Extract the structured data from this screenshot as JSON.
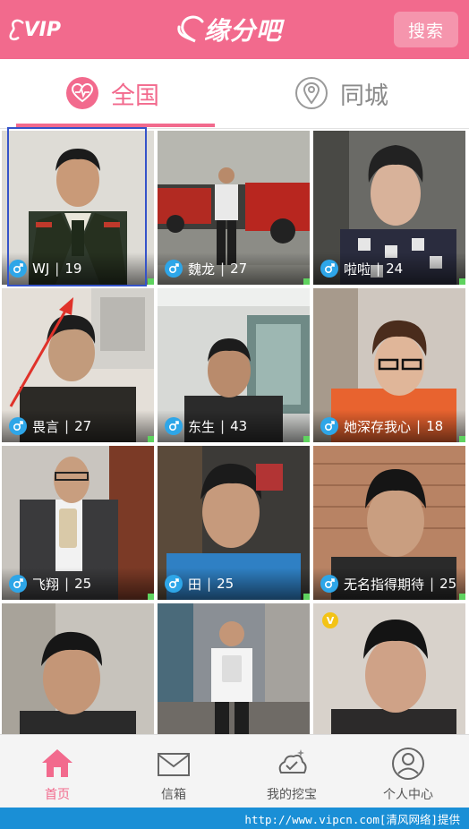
{
  "header": {
    "vip_label": "VIP",
    "logo_text": "缘分吧",
    "search_label": "搜索",
    "brand_color": "#f26a8d"
  },
  "tabs": [
    {
      "label": "全国",
      "icon": "heart-pulse-icon",
      "active": true
    },
    {
      "label": "同城",
      "icon": "location-pin-icon",
      "active": false
    }
  ],
  "users": [
    {
      "name": "WJ",
      "age": "19",
      "gender": "male"
    },
    {
      "name": "魏龙",
      "age": "27",
      "gender": "male"
    },
    {
      "name": "啦啦",
      "age": "24",
      "gender": "male"
    },
    {
      "name": "畏言",
      "age": "27",
      "gender": "male"
    },
    {
      "name": "东生",
      "age": "43",
      "gender": "male"
    },
    {
      "name": "她深存我心",
      "age": "18",
      "gender": "male"
    },
    {
      "name": "飞翔",
      "age": "25",
      "gender": "male"
    },
    {
      "name": "田",
      "age": "25",
      "gender": "male"
    },
    {
      "name": "无名指得期待",
      "age": "25",
      "gender": "male"
    }
  ],
  "vip_badge": "V",
  "bottom_nav": [
    {
      "label": "首页",
      "icon": "home-icon",
      "active": true
    },
    {
      "label": "信箱",
      "icon": "mail-icon",
      "active": false
    },
    {
      "label": "我的挖宝",
      "icon": "treasure-icon",
      "active": false
    },
    {
      "label": "个人中心",
      "icon": "person-icon",
      "active": false
    }
  ],
  "watermark": "http://www.vipcn.com[清风网络]提供",
  "colors": {
    "gender_badge": "#2ea6e8",
    "online_dot": "#5fd35f",
    "selection_frame": "#3553c9",
    "annotation_arrow": "#e0322a"
  }
}
